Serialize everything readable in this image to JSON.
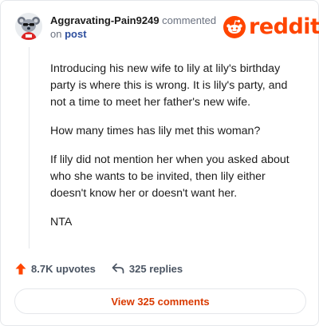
{
  "comment": {
    "username": "Aggravating-Pain9249",
    "action_text": "commented",
    "on_text": "on",
    "post_link": "post",
    "paragraphs": [
      "Introducing his new wife to lily at lily's birthday party is where this is wrong. It is lily's party, and not a time to meet her father's new wife.",
      "How many times has lily met this woman?",
      "If lily did not mention her when you asked about who she wants to be invited, then lily either doesn't know her or doesn't want her.",
      "NTA"
    ]
  },
  "brand": {
    "logo_text": "reddit",
    "color": "#ff4500"
  },
  "stats": {
    "upvotes": "8.7K upvotes",
    "replies": "325 replies"
  },
  "view_button": {
    "label": "View 325 comments"
  },
  "icons": {
    "avatar": "koala-avatar-icon",
    "logo": "reddit-snoo-icon",
    "upvote": "upvote-arrow-icon",
    "reply": "reply-arrow-icon"
  }
}
